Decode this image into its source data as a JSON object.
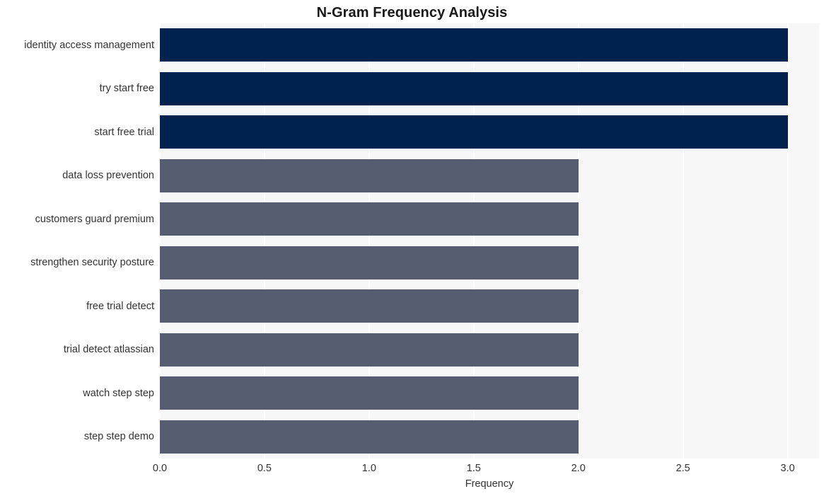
{
  "chart_data": {
    "type": "bar",
    "orientation": "horizontal",
    "title": "N-Gram Frequency Analysis",
    "xlabel": "Frequency",
    "ylabel": "",
    "xlim": [
      0.0,
      3.15
    ],
    "xticks": [
      "0.0",
      "0.5",
      "1.0",
      "1.5",
      "2.0",
      "2.5",
      "3.0"
    ],
    "xtick_values": [
      0.0,
      0.5,
      1.0,
      1.5,
      2.0,
      2.5,
      3.0
    ],
    "grid": true,
    "legend": "none",
    "categories": [
      "identity access management",
      "try start free",
      "start free trial",
      "data loss prevention",
      "customers guard premium",
      "strengthen security posture",
      "free trial detect",
      "trial detect atlassian",
      "watch step step",
      "step step demo"
    ],
    "values": [
      3,
      3,
      3,
      2,
      2,
      2,
      2,
      2,
      2,
      2
    ],
    "bar_colors": [
      "#00234d",
      "#00234d",
      "#00234d",
      "#575d70",
      "#575d70",
      "#575d70",
      "#575d70",
      "#575d70",
      "#575d70",
      "#575d70"
    ]
  },
  "style": {
    "plot_background": "#f7f7f8",
    "figure_background": "#ffffff",
    "gridline_color": "#ffffff",
    "title_color": "#1a1a1a",
    "tick_color": "#333333",
    "accent_dark": "#00234d",
    "accent_muted": "#575d70"
  }
}
